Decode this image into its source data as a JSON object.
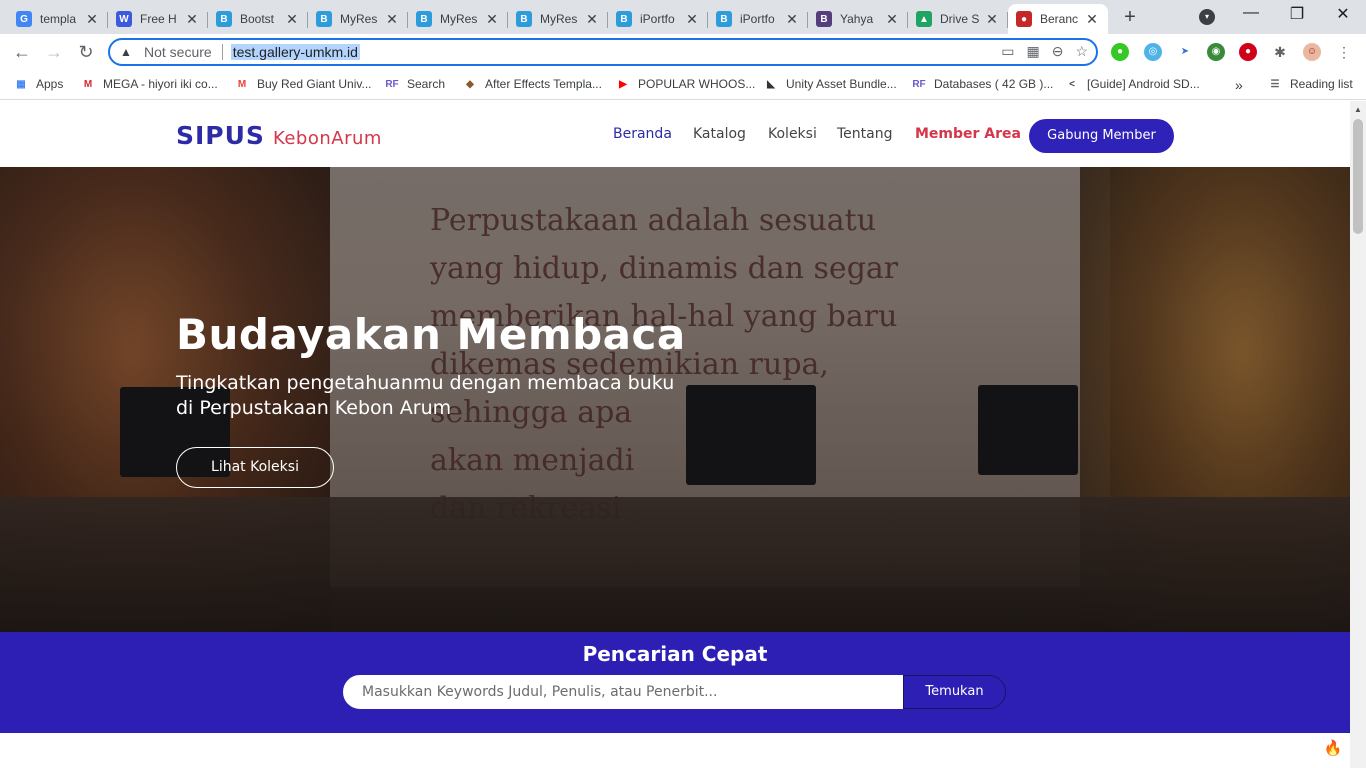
{
  "browser": {
    "tabs": [
      {
        "title": "templa",
        "icon": "google-icon",
        "color": "#4285f4",
        "glyph": "G"
      },
      {
        "title": "Free H",
        "icon": "w-icon",
        "color": "#3b5bdb",
        "glyph": "W"
      },
      {
        "title": "Bootst",
        "icon": "b-swoosh-icon",
        "color": "#2d9cdb",
        "glyph": "B"
      },
      {
        "title": "MyRes",
        "icon": "b-swoosh-icon",
        "color": "#2d9cdb",
        "glyph": "B"
      },
      {
        "title": "MyRes",
        "icon": "b-swoosh-icon",
        "color": "#2d9cdb",
        "glyph": "B"
      },
      {
        "title": "MyRes",
        "icon": "b-swoosh-icon",
        "color": "#2d9cdb",
        "glyph": "B"
      },
      {
        "title": "iPortfo",
        "icon": "b-swoosh-icon",
        "color": "#2d9cdb",
        "glyph": "B"
      },
      {
        "title": "iPortfo",
        "icon": "b-swoosh-icon",
        "color": "#2d9cdb",
        "glyph": "B"
      },
      {
        "title": "Yahya",
        "icon": "bootstrap-icon",
        "color": "#563d7c",
        "glyph": "B"
      },
      {
        "title": "Drive S",
        "icon": "drive-icon",
        "color": "#1fa463",
        "glyph": "▲"
      },
      {
        "title": "Beranc",
        "icon": "site-icon",
        "color": "#c62828",
        "glyph": "●"
      }
    ],
    "address": {
      "security": "Not secure",
      "url": "test.gallery-umkm.id"
    },
    "bookmarks": [
      {
        "label": "Apps",
        "icon": "apps-icon",
        "color": "#4285f4",
        "glyph": "▦"
      },
      {
        "label": "MEGA - hiyori iki co...",
        "icon": "mega-icon",
        "color": "#d9272e",
        "glyph": "M"
      },
      {
        "label": "Buy Red Giant Univ...",
        "icon": "gmail-icon",
        "color": "#ea4335",
        "glyph": "M"
      },
      {
        "label": "Search",
        "icon": "rf-icon",
        "color": "#6a5acd",
        "glyph": "RF"
      },
      {
        "label": "After Effects Templa...",
        "icon": "ae-icon",
        "color": "#8b5a2b",
        "glyph": "◆"
      },
      {
        "label": "POPULAR WHOOS...",
        "icon": "youtube-icon",
        "color": "#ff0000",
        "glyph": "▶"
      },
      {
        "label": "Unity Asset Bundle...",
        "icon": "unity-icon",
        "color": "#333333",
        "glyph": "◣"
      },
      {
        "label": "Databases ( 42 GB )...",
        "icon": "rf-icon",
        "color": "#6a5acd",
        "glyph": "RF"
      },
      {
        "label": "[Guide] Android SD...",
        "icon": "xda-icon",
        "color": "#444444",
        "glyph": "<"
      }
    ],
    "bookmarks_more": "»",
    "reading_list": "Reading list"
  },
  "site": {
    "brand_main": "SIPUS",
    "brand_sub": "KebonArum",
    "nav": [
      "Beranda",
      "Katalog",
      "Koleksi",
      "Tentang"
    ],
    "member_area": "Member Area",
    "join_label": "Gabung Member"
  },
  "hero": {
    "title": "Budayakan Membaca",
    "subtitle_line1": "Tingkatkan pengetahuanmu dengan membaca buku",
    "subtitle_line2": "di Perpustakaan Kebon Arum",
    "cta": "Lihat Koleksi",
    "wall_quote": "Perpustakaan adalah sesuatu\nyang hidup, dinamis dan segar\nmemberikan hal-hal yang baru\ndikemas sedemikian rupa,\nsehingga apa\nakan menjadi\ndan rekreasi"
  },
  "quick_search": {
    "title": "Pencarian Cepat",
    "placeholder": "Masukkan Keywords Judul, Penulis, atau Penerbit...",
    "button": "Temukan"
  }
}
